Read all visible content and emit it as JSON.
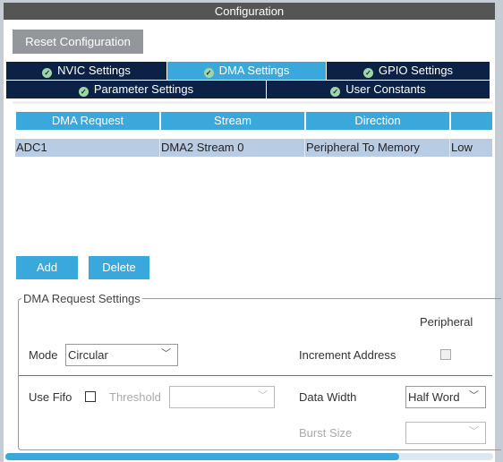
{
  "window": {
    "title": "Configuration"
  },
  "toolbar": {
    "reset_label": "Reset Configuration"
  },
  "tabs": [
    {
      "label": "NVIC Settings",
      "active": false
    },
    {
      "label": "DMA Settings",
      "active": true
    },
    {
      "label": "GPIO Settings",
      "active": false
    },
    {
      "label": "Parameter Settings",
      "active": false
    },
    {
      "label": "User Constants",
      "active": false
    }
  ],
  "table": {
    "headers": [
      "DMA Request",
      "Stream",
      "Direction",
      ""
    ],
    "rows": [
      [
        "ADC1",
        "DMA2 Stream 0",
        "Peripheral To Memory",
        "Low"
      ]
    ]
  },
  "actions": {
    "add": "Add",
    "delete": "Delete"
  },
  "settings": {
    "title": "DMA Request Settings",
    "peripheral_header": "Peripheral",
    "mode_label": "Mode",
    "mode_value": "Circular",
    "increment_label": "Increment Address",
    "increment_checked": false,
    "fifo_label": "Use Fifo",
    "fifo_checked": false,
    "threshold_label": "Threshold",
    "threshold_value": "",
    "data_width_label": "Data Width",
    "data_width_value": "Half Word",
    "burst_label": "Burst Size",
    "burst_value": ""
  },
  "colors": {
    "accent": "#3ba8dc",
    "tab_bg": "#0b2146",
    "row_selected": "#b8cce4"
  }
}
